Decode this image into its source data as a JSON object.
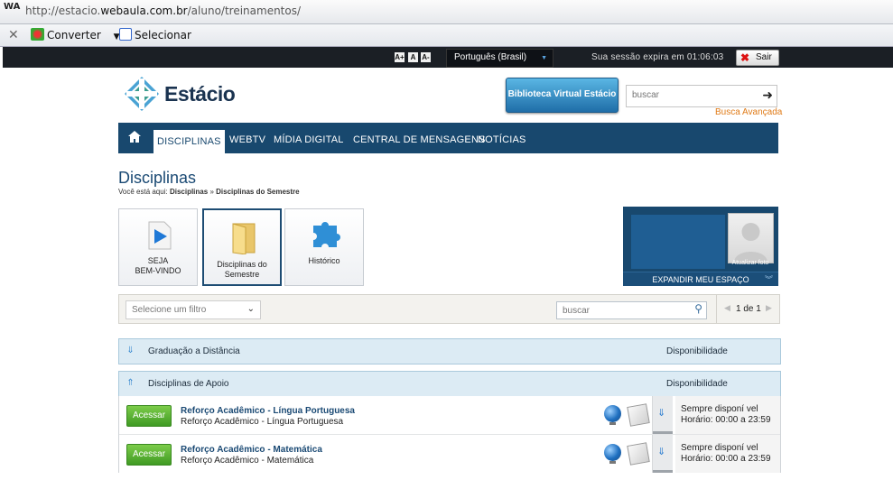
{
  "browser": {
    "url_prefix": "http://estacio.",
    "url_host": "webaula.com.br",
    "url_path": "/aluno/treinamentos/",
    "wa_logo": "WA",
    "converter_label": "Converter",
    "selecionar_label": "Selecionar"
  },
  "topbar": {
    "font_buttons": [
      "A+",
      "A",
      "A-"
    ],
    "language": "Português (Brasil)",
    "session_text": "Sua sessão expira em 01:06:03",
    "logout_label": "Sair"
  },
  "header": {
    "logo_text": "Estácio",
    "library_button": "Biblioteca Virtual Estácio",
    "search_placeholder": "buscar",
    "advanced_search": "Busca Avançada"
  },
  "nav": {
    "tabs": [
      "DISCIPLINAS",
      "WEBTV",
      "MÍDIA DIGITAL",
      "CENTRAL DE MENSAGENS",
      "NOTÍCIAS"
    ]
  },
  "page": {
    "title": "Disciplinas",
    "breadcrumb_prefix": "Você está aqui:",
    "breadcrumb_1": "Disciplinas",
    "breadcrumb_sep": "»",
    "breadcrumb_2": "Disciplinas do Semestre"
  },
  "tiles": [
    {
      "line1": "SEJA",
      "line2": "BEM-VINDO"
    },
    {
      "line1": "Disciplinas do",
      "line2": "Semestre"
    },
    {
      "line1": "Histórico",
      "line2": ""
    }
  ],
  "profile": {
    "photo_caption": "Atualizar foto",
    "expand_label": "EXPANDIR MEU ESPAÇO"
  },
  "filter": {
    "select_value": "Selecione um filtro",
    "search_placeholder": "buscar",
    "page_info": "1 de 1"
  },
  "groups": [
    {
      "name": "Graduação a Distância",
      "availability": "Disponibilidade"
    },
    {
      "name": "Disciplinas de Apoio",
      "availability": "Disponibilidade"
    }
  ],
  "courses": [
    {
      "button": "Acessar",
      "title": "Reforço Acadêmico - Língua Portuguesa",
      "subtitle": "Reforço Acadêmico - Língua Portuguesa",
      "avail1": "Sempre disponí vel",
      "avail2": "Horário: 00:00 a 23:59"
    },
    {
      "button": "Acessar",
      "title": "Reforço Acadêmico - Matemática",
      "subtitle": "Reforço Acadêmico - Matemática",
      "avail1": "Sempre disponí vel",
      "avail2": "Horário: 00:00 a 23:59"
    }
  ],
  "colors": {
    "nav_blue": "#18486e",
    "accent_orange": "#e07b18",
    "button_green": "#4fae2d"
  }
}
